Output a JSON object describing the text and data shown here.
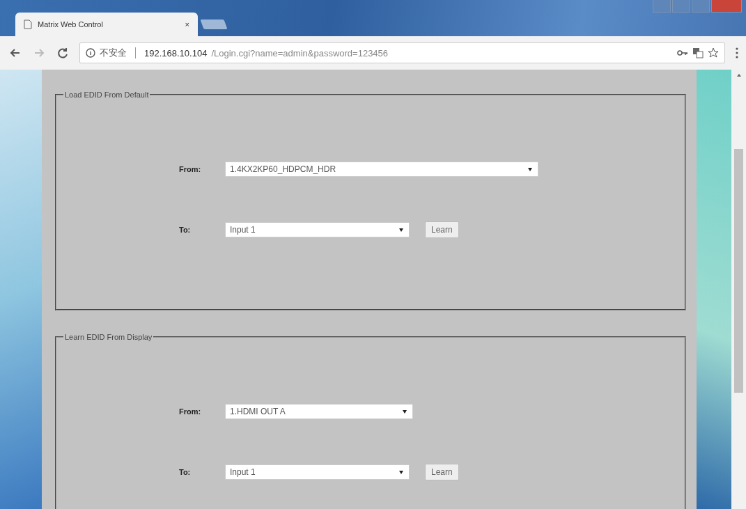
{
  "browser": {
    "tab": {
      "title": "Matrix Web Control",
      "close": "×"
    },
    "address": {
      "security": "不安全",
      "host": "192.168.10.104",
      "path": "/Login.cgi?name=admin&password=123456"
    }
  },
  "sections": [
    {
      "legend": "Load EDID From Default",
      "from": {
        "label": "From:",
        "value": "1.4KX2KP60_HDPCM_HDR"
      },
      "to": {
        "label": "To:",
        "value": "Input 1"
      },
      "button": "Learn"
    },
    {
      "legend": "Learn EDID From Display",
      "from": {
        "label": "From:",
        "value": "1.HDMI OUT A"
      },
      "to": {
        "label": "To:",
        "value": "Input 1"
      },
      "button": "Learn"
    }
  ]
}
